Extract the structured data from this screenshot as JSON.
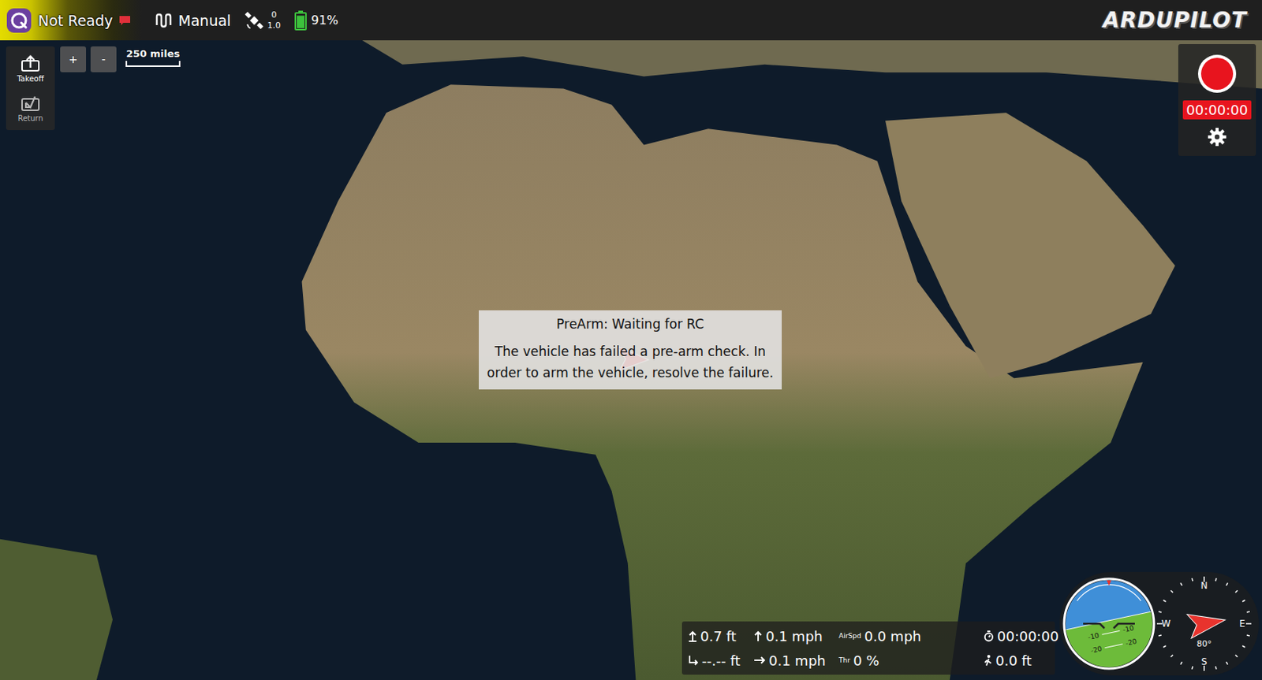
{
  "toolbar": {
    "status": "Not Ready",
    "mode": "Manual",
    "gps": {
      "count": "0",
      "hdop": "1.0"
    },
    "battery": {
      "percent": "91%",
      "level": 0.91
    },
    "brand": "ARDUPILOT"
  },
  "left_tools": [
    {
      "label": "Takeoff",
      "disabled": false
    },
    {
      "label": "Return",
      "disabled": true
    }
  ],
  "zoom": [
    "+",
    "-"
  ],
  "scale": {
    "label": "250 miles"
  },
  "recorder": {
    "time": "00:00:00",
    "recording": false
  },
  "prearm": {
    "title": "PreArm: Waiting for RC",
    "message": "The vehicle has failed a pre-arm check. In order to arm the vehicle, resolve the failure."
  },
  "telemetry": [
    {
      "kind": "altitude",
      "value": "0.7 ft"
    },
    {
      "kind": "climb",
      "value": "0.1 mph"
    },
    {
      "kind": "labeled",
      "label": "AirSpd",
      "value": "0.0 mph"
    },
    {
      "kind": "timer",
      "value": "00:00:00"
    },
    {
      "kind": "amsl",
      "value": "--.-- ft"
    },
    {
      "kind": "ground-speed",
      "value": "0.1 mph"
    },
    {
      "kind": "labeled",
      "label": "Thr",
      "value": "0 %"
    },
    {
      "kind": "distance",
      "value": "0.0 ft"
    }
  ],
  "attitude": {
    "pitch_labels": [
      "-10",
      "-20"
    ]
  },
  "compass": {
    "cardinals": [
      "N",
      "E",
      "S",
      "W"
    ],
    "heading": "80°"
  }
}
